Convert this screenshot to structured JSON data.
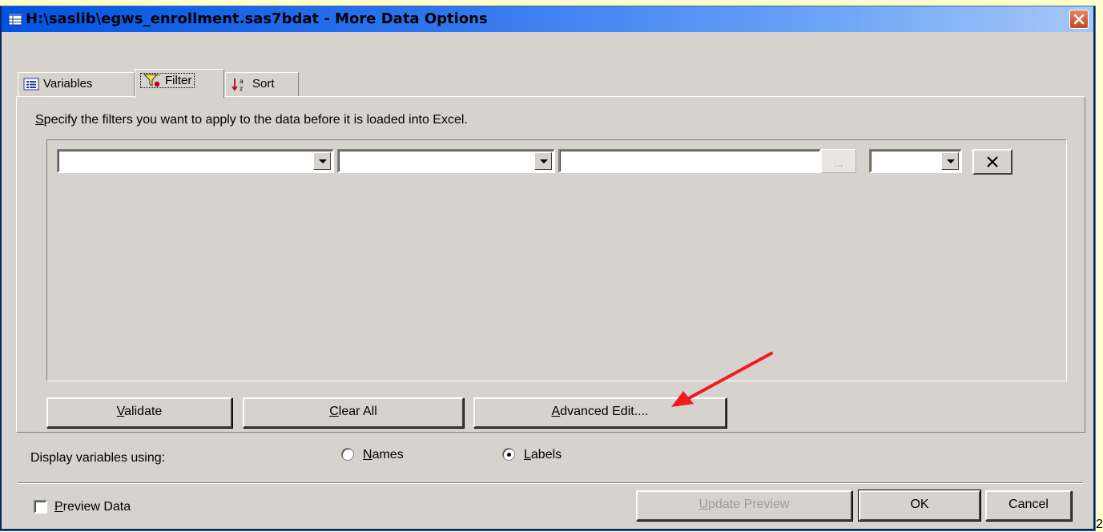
{
  "window": {
    "title": "H:\\saslib\\egws_enrollment.sas7bdat - More Data Options",
    "title_icon": "dataset-icon",
    "close_icon": "close-icon"
  },
  "tabs": [
    {
      "label": "Variables",
      "icon": "list-icon",
      "active": false
    },
    {
      "label": "Filter",
      "icon": "funnel-icon",
      "active": true
    },
    {
      "label": "Sort",
      "icon": "sort-az-icon",
      "active": false
    }
  ],
  "filter": {
    "instruction_first": "S",
    "instruction_rest": "pecify the filters you want to apply to the data before it is loaded into Excel.",
    "row": {
      "variable_value": "",
      "operator_value": "",
      "value_text": "",
      "ellipsis_label": "...",
      "connector_value": "",
      "delete_icon": "delete-x-icon"
    },
    "buttons": {
      "validate_mnemonic": "V",
      "validate_rest": "alidate",
      "clear_mnemonic": "C",
      "clear_rest": "lear All",
      "advanced_mnemonic": "A",
      "advanced_rest": "dvanced Edit...."
    }
  },
  "display": {
    "label": "Display variables using:",
    "names_mnemonic": "N",
    "names_rest": "ames",
    "labels_mnemonic": "L",
    "labels_rest": "abels",
    "selected": "Labels"
  },
  "footer": {
    "preview_mnemonic": "P",
    "preview_rest": "review Data",
    "preview_checked": false,
    "update_mnemonic": "U",
    "update_rest": "pdate Preview",
    "ok_label": "OK",
    "cancel_label": "Cancel"
  },
  "page_number": "2",
  "annotation": {
    "color": "#ee1c1c"
  }
}
